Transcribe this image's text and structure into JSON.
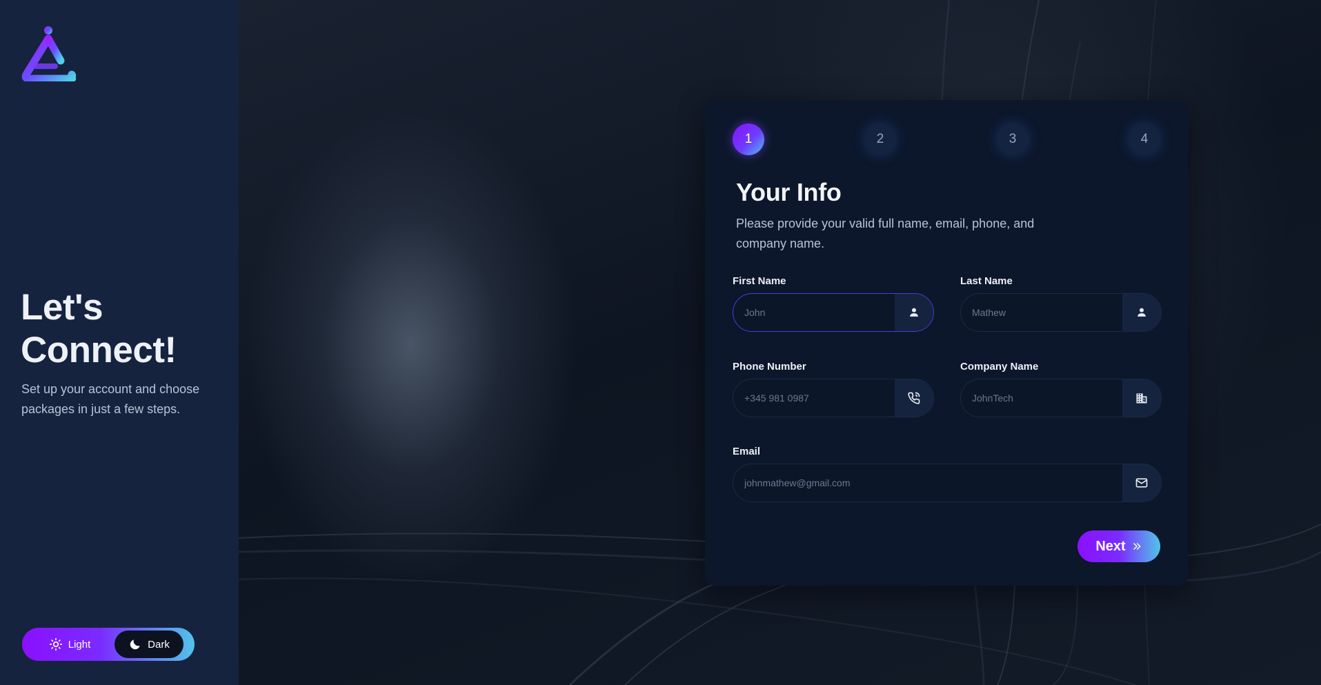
{
  "sidebar": {
    "hero_title": "Let's Connect!",
    "hero_subtitle": "Set up your account and choose packages in just a few steps.",
    "theme_toggle": {
      "light_label": "Light",
      "dark_label": "Dark",
      "selected": "Dark"
    }
  },
  "stepper": {
    "steps": [
      "1",
      "2",
      "3",
      "4"
    ],
    "active_step": 1
  },
  "form": {
    "title": "Your Info",
    "description": "Please provide your valid full name, email, phone, and company name.",
    "first_name": {
      "label": "First Name",
      "placeholder": "John",
      "icon": "user-icon"
    },
    "last_name": {
      "label": "Last Name",
      "placeholder": "Mathew",
      "icon": "user-icon"
    },
    "phone": {
      "label": "Phone Number",
      "placeholder": "+345 981 0987",
      "icon": "phone-icon"
    },
    "company": {
      "label": "Company Name",
      "placeholder": "JohnTech",
      "icon": "building-icon"
    },
    "email": {
      "label": "Email",
      "placeholder": "johnmathew@gmail.com",
      "icon": "mail-icon"
    },
    "next_label": "Next"
  },
  "colors": {
    "sidebar_bg": "#16233f",
    "card_bg": "#0c172b",
    "accent_purple": "#8a10ff",
    "accent_cyan": "#52c4e8"
  }
}
